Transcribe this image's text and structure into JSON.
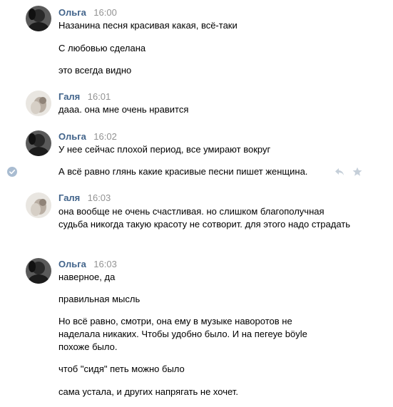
{
  "messages": [
    {
      "author": "Ольга",
      "time": "16:00",
      "lines": [
        "Назанина песня красивая какая, всё-таки",
        "С любовью сделана",
        "это всегда видно"
      ]
    },
    {
      "author": "Галя",
      "time": "16:01",
      "lines": [
        "дааа. она мне очень нравится"
      ]
    },
    {
      "author": "Ольга",
      "time": "16:02",
      "lines": [
        "У нее сейчас плохой период, все умирают вокруг",
        "А всё равно глянь какие красивые песни пишет женщина."
      ]
    },
    {
      "author": "Галя",
      "time": "16:03",
      "lines": [
        "она вообще не очень счастливая. но слишком благополучная судьба никогда такую красоту не сотворит. для этого надо страдать"
      ]
    },
    {
      "author": "Ольга",
      "time": "16:03",
      "lines": [
        "наверное, да",
        "правильная мысль",
        "Но всё равно, смотри, она ему в музыке наворотов не наделала никаких. Чтобы удобно было. И на пегеуе böyle похоже было.",
        "чтоб \"сидя\" петь можно было",
        "сама устала, и других напрягать не хочет."
      ]
    }
  ],
  "icons": {
    "selected": "check-circle-icon",
    "reply": "reply-icon",
    "favorite": "star-icon"
  },
  "colors": {
    "author": "#42648b",
    "time": "#939393",
    "text": "#000000",
    "check": "#a9bcd1",
    "action_icons": "#c5cfd9"
  }
}
